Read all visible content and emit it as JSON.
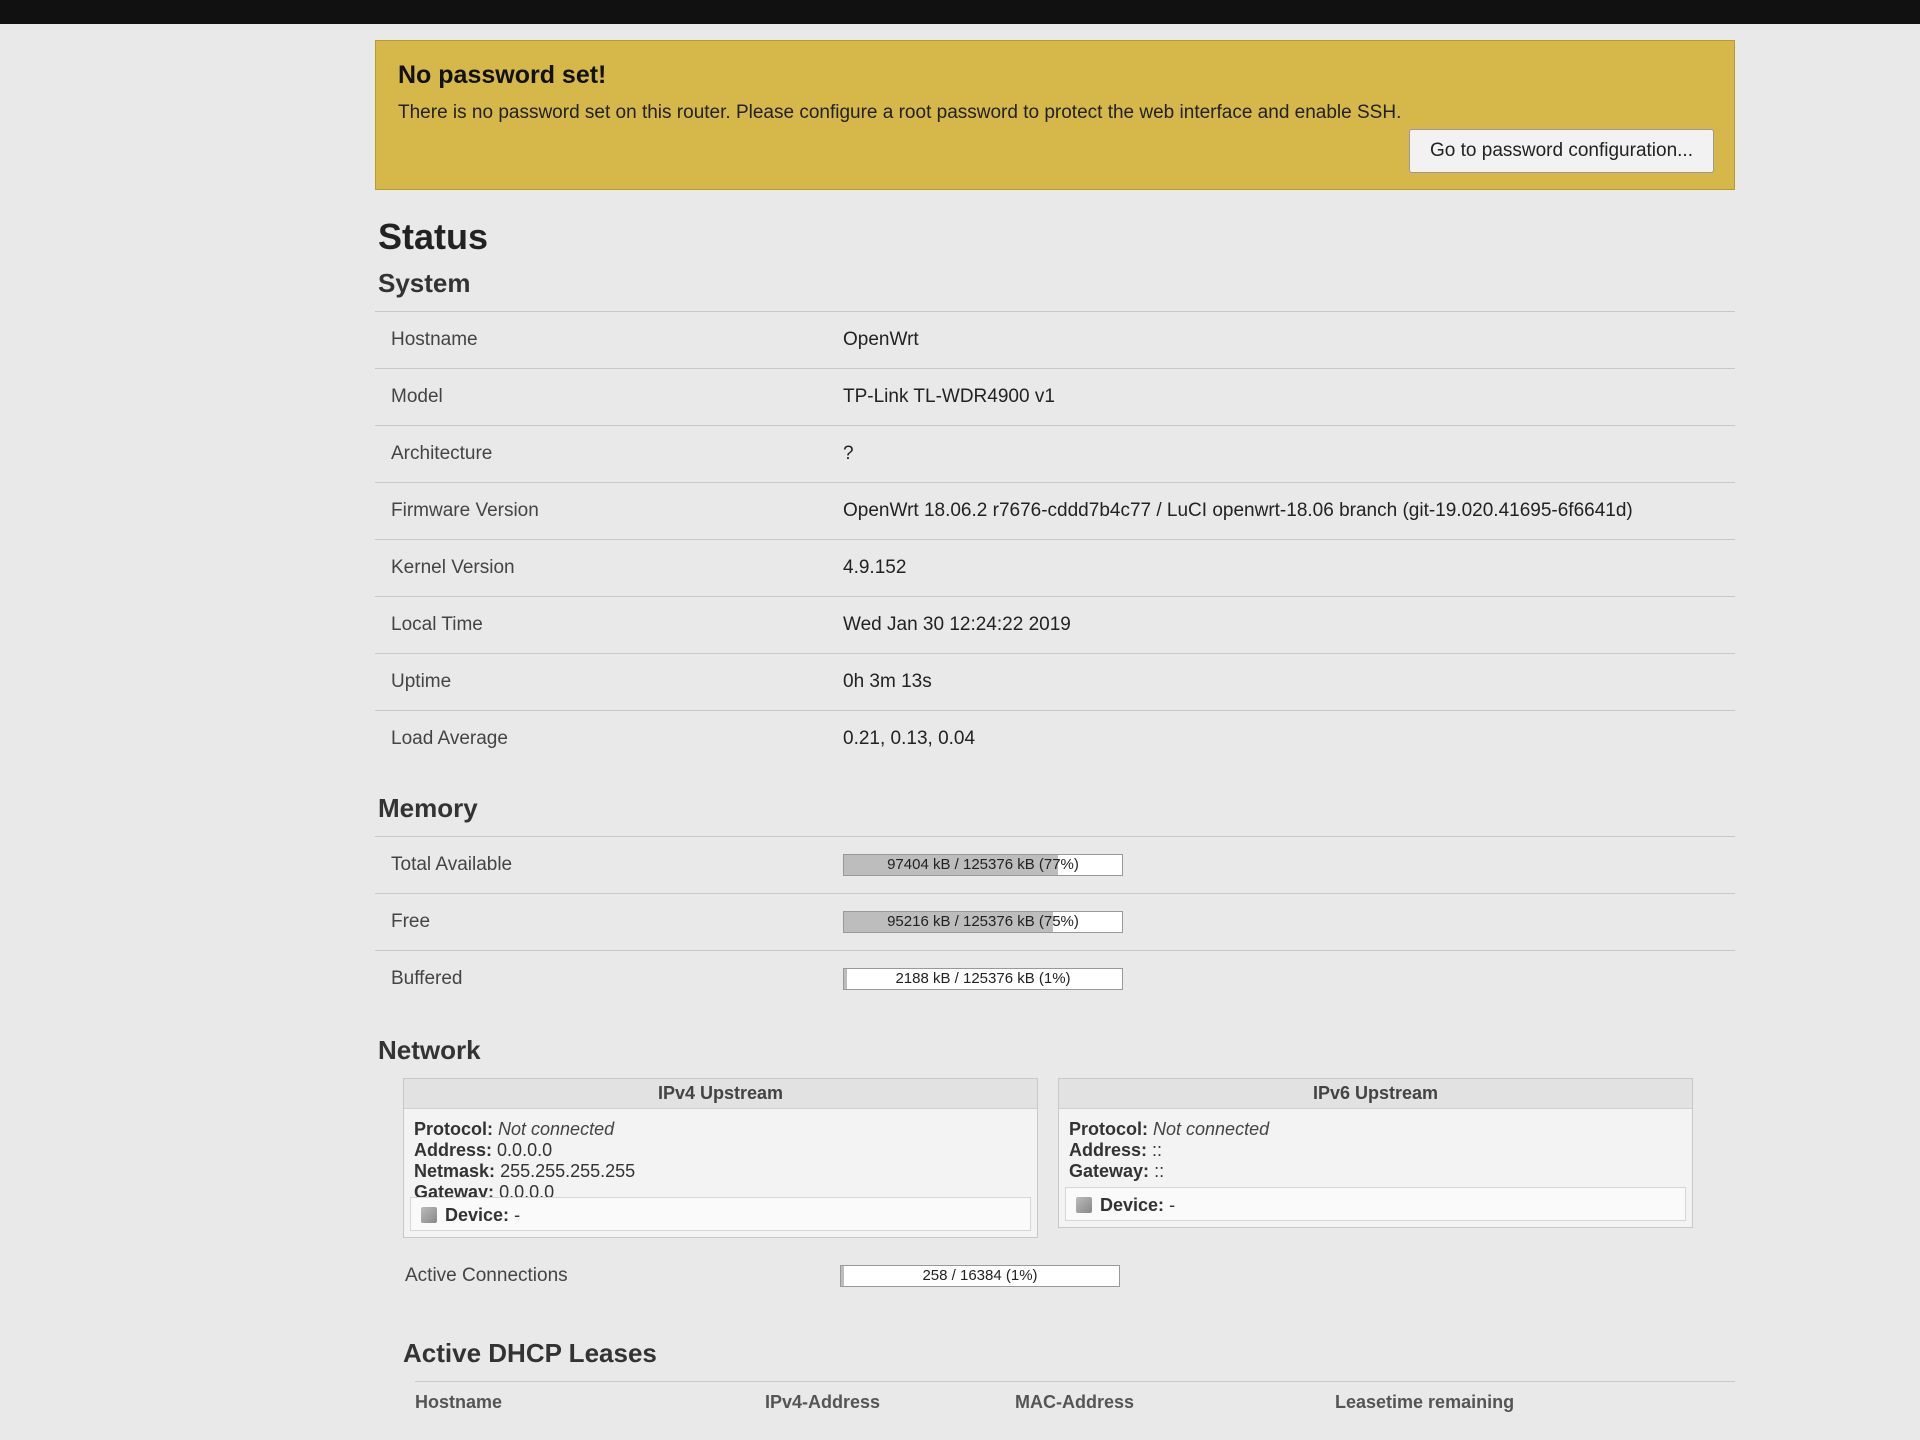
{
  "alert": {
    "title": "No password set!",
    "message": "There is no password set on this router. Please configure a root password to protect the web interface and enable SSH.",
    "button_label": "Go to password configuration..."
  },
  "page_title": "Status",
  "system": {
    "heading": "System",
    "rows": [
      {
        "key": "Hostname",
        "value": "OpenWrt"
      },
      {
        "key": "Model",
        "value": "TP-Link TL-WDR4900 v1"
      },
      {
        "key": "Architecture",
        "value": "?"
      },
      {
        "key": "Firmware Version",
        "value": "OpenWrt 18.06.2 r7676-cddd7b4c77 / LuCI openwrt-18.06 branch (git-19.020.41695-6f6641d)"
      },
      {
        "key": "Kernel Version",
        "value": "4.9.152"
      },
      {
        "key": "Local Time",
        "value": "Wed Jan 30 12:24:22 2019"
      },
      {
        "key": "Uptime",
        "value": "0h 3m 13s"
      },
      {
        "key": "Load Average",
        "value": "0.21, 0.13, 0.04"
      }
    ]
  },
  "memory": {
    "heading": "Memory",
    "rows": [
      {
        "key": "Total Available",
        "text": "97404 kB / 125376 kB (77%)",
        "percent": 77
      },
      {
        "key": "Free",
        "text": "95216 kB / 125376 kB (75%)",
        "percent": 75
      },
      {
        "key": "Buffered",
        "text": "2188 kB / 125376 kB (1%)",
        "percent": 1
      }
    ]
  },
  "network": {
    "heading": "Network",
    "ipv4": {
      "title": "IPv4 Upstream",
      "protocol_label": "Protocol:",
      "protocol": "Not connected",
      "address_label": "Address:",
      "address": "0.0.0.0",
      "netmask_label": "Netmask:",
      "netmask": "255.255.255.255",
      "gateway_label": "Gateway:",
      "gateway": "0.0.0.0",
      "device_label": "Device:",
      "device": "-"
    },
    "ipv6": {
      "title": "IPv6 Upstream",
      "protocol_label": "Protocol:",
      "protocol": "Not connected",
      "address_label": "Address:",
      "address": "::",
      "gateway_label": "Gateway:",
      "gateway": "::",
      "device_label": "Device:",
      "device": "-"
    },
    "active_connections": {
      "key": "Active Connections",
      "text": "258 / 16384 (1%)",
      "percent": 1
    }
  },
  "dhcp": {
    "heading": "Active DHCP Leases",
    "columns": [
      "Hostname",
      "IPv4-Address",
      "MAC-Address",
      "Leasetime remaining"
    ]
  },
  "colors": {
    "alert_bg": "#d6b74a",
    "page_bg": "#e9e9e9",
    "progress_fill": "#bdbdbd"
  }
}
